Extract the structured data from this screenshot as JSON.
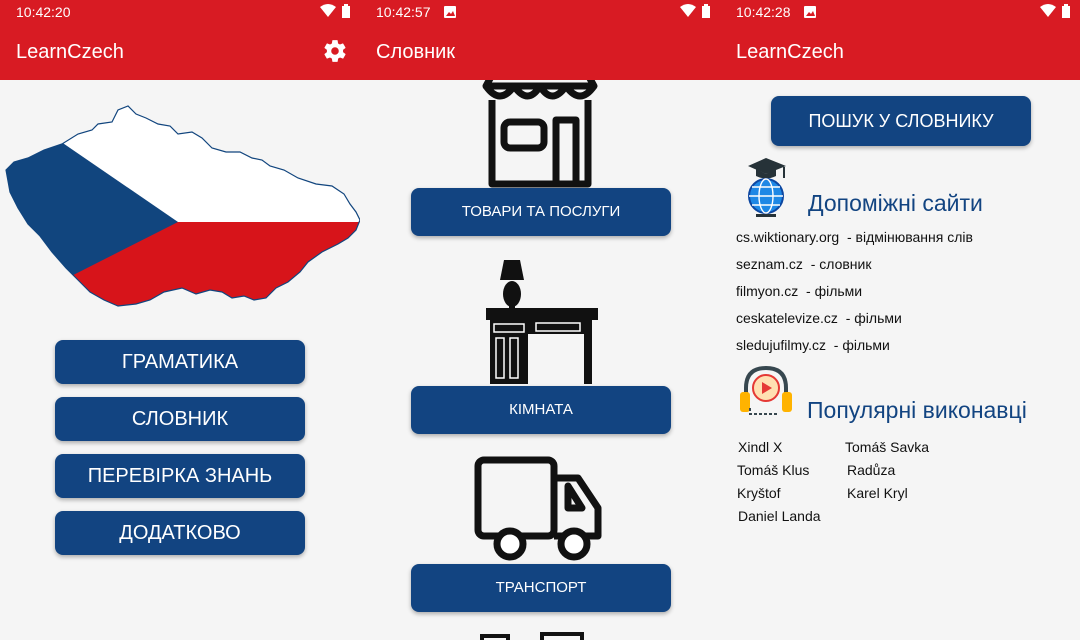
{
  "screens": [
    {
      "status_time": "10:42:20",
      "title": "LearnCzech",
      "settings_icon": "gear-icon",
      "buttons": [
        "ГРАМАТИКА",
        "СЛОВНИК",
        "ПЕРЕВІРКА ЗНАНЬ",
        "ДОДАТКОВО"
      ]
    },
    {
      "status_time": "10:42:57",
      "title": "Словник",
      "categories": [
        "ТОВАРИ ТА ПОСЛУГИ",
        "КІМНАТА",
        "ТРАНСПОРТ"
      ]
    },
    {
      "status_time": "10:42:28",
      "title": "LearnCzech",
      "search_button": "ПОШУК У СЛОВНИКУ",
      "sites_title": "Допоміжні сайти",
      "sites": [
        {
          "site": "cs.wiktionary.org",
          "desc": "- відмінювання слів"
        },
        {
          "site": "seznam.cz",
          "desc": "- словник"
        },
        {
          "site": "filmyon.cz",
          "desc": "- фільми"
        },
        {
          "site": "ceskatelevize.cz",
          "desc": "- фільми"
        },
        {
          "site": "sledujufilmy.cz",
          "desc": "- фільми"
        }
      ],
      "artists_title": "Популярні виконавці",
      "artists_left": [
        "Xindl X",
        "Tomáš Klus",
        "Kryštof",
        "Daniel Landa"
      ],
      "artists_right": [
        "Tomáš Savka",
        "Radůza",
        "Karel Kryl"
      ]
    }
  ],
  "colors": {
    "appbar": "#d81b23",
    "button": "#124481",
    "background": "#f5f5f5"
  }
}
